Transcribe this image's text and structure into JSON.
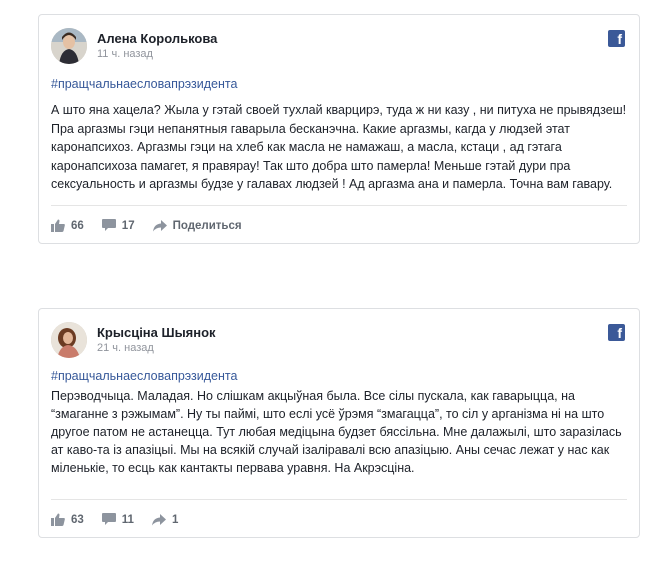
{
  "posts": [
    {
      "author": "Алена Королькова",
      "time": "11 ч. назад",
      "hashtag": "#пращчальнаесловапрэзидента",
      "text": "А што яна хацела? Жыла у гэтай своей тухлай кварцирэ, туда ж ни казу , ни питуха не прывядзеш! Пра аргазмы гэци непанятныя гаварыла бесканэчна. Какие аргазмы, кагда у людзей этат каронапсихоз. Аргазмы гэци на хлеб как масла не намажаш, а масла, кстаци , ад гэтага каронапсихоза памагет, я правярау! Так што добра што памерла! Меньше гэтай дури пра сексуальность и аргазмы будзе у галавах людзей ! Ад аргазма ана и памерла. Точна вам гавару.",
      "likes": "66",
      "comments": "17",
      "share_label": "Поделиться",
      "icon": "facebook-icon"
    },
    {
      "author": "Крысціна Шыянок",
      "time": "21 ч. назад",
      "hashtag": "#пращчальнаесловапрэзидента",
      "text": "Перэводчыца. Маладая. Но слішкам акцыўная была. Все сілы пускала, как гаварыцца, на “змаганне з рэжымам”. Ну ты паймі, што еслі усё ўрэмя “змагацца”, то сіл у арганізма ні на што другое патом не астанецца. Тут любая медіцына будзет бяссільна. Мне далажылі, што заразілась ат каво-та із апазіцыі. Мы на всякій случай ізаліравалі всю апазіцыю. Аны сечас лежат у нас как міленькіе, то есць как кантакты первава уравня. На Акрэсціна.",
      "likes": "63",
      "comments": "11",
      "shares": "1",
      "icon": "facebook-icon"
    }
  ],
  "colors": {
    "facebook_blue": "#3b5998",
    "hashtag": "#365899",
    "muted": "#90949c"
  }
}
